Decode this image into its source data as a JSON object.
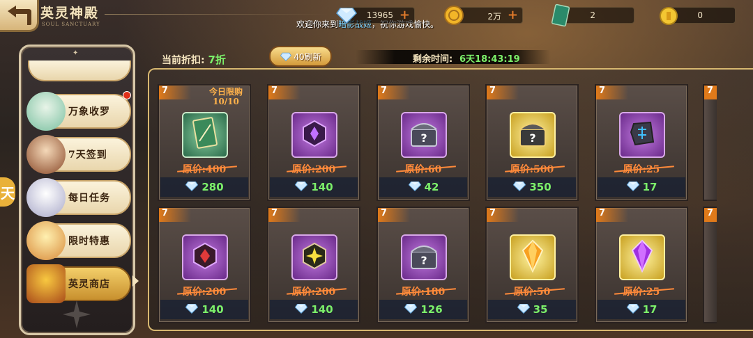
{
  "header": {
    "title": "英灵神殿",
    "subtitle": "SOUL SANCTUARY",
    "welcome_prefix": "欢迎你来到",
    "welcome_highlight": "暗影战姬",
    "welcome_suffix": "，祝你游戏愉快。"
  },
  "resources": [
    {
      "icon": "diamond-icon",
      "value": "13965",
      "has_plus": true
    },
    {
      "icon": "gold-coin-icon",
      "value": "2万",
      "has_plus": true
    },
    {
      "icon": "ticket-card-icon",
      "value": "2",
      "has_plus": false
    },
    {
      "icon": "token-coin-icon",
      "value": "0",
      "has_plus": false
    }
  ],
  "sidebar": {
    "items": [
      {
        "label": "万象收罗",
        "has_red_dot": true,
        "active": false
      },
      {
        "label": "7天签到",
        "has_red_dot": false,
        "active": false
      },
      {
        "label": "每日任务",
        "has_red_dot": false,
        "active": false
      },
      {
        "label": "限时特惠",
        "has_red_dot": false,
        "active": false
      },
      {
        "label": "英灵商店",
        "has_red_dot": false,
        "active": true
      }
    ],
    "left_tab_label": "天"
  },
  "shop": {
    "discount_label": "当前折扣:",
    "discount_value": "7折",
    "refresh_label": "40刷新",
    "timer_label": "剩余时间:",
    "timer_value": "6天18:43:19",
    "orig_price_prefix": "原价:",
    "items": [
      {
        "badge": "7",
        "limit_title": "今日限购",
        "limit_count": "10/10",
        "item_icon": "green-card-icon",
        "box_color": "green",
        "orig_price": "400",
        "price": "280"
      },
      {
        "badge": "7",
        "item_icon": "purple-crystal-icon",
        "box_color": "purple",
        "orig_price": "200",
        "price": "140"
      },
      {
        "badge": "7",
        "item_icon": "mystery-chest-icon",
        "box_color": "purple",
        "orig_price": "60",
        "price": "42"
      },
      {
        "badge": "7",
        "item_icon": "gold-mystery-chest-icon",
        "box_color": "gold",
        "orig_price": "500",
        "price": "350"
      },
      {
        "badge": "7",
        "item_icon": "rune-stone-icon",
        "box_color": "purple",
        "orig_price": "25",
        "price": "17"
      },
      {
        "badge": "7",
        "item_icon": "red-crystal-icon",
        "box_color": "purple",
        "orig_price": "200",
        "price": "140"
      },
      {
        "badge": "7",
        "item_icon": "yellow-star-crystal-icon",
        "box_color": "purple",
        "orig_price": "200",
        "price": "140"
      },
      {
        "badge": "7",
        "item_icon": "mystery-chest-icon",
        "box_color": "purple",
        "orig_price": "180",
        "price": "126"
      },
      {
        "badge": "7",
        "item_icon": "orange-gem-icon",
        "box_color": "gold",
        "orig_price": "50",
        "price": "35"
      },
      {
        "badge": "7",
        "item_icon": "purple-gem-icon",
        "box_color": "gold",
        "orig_price": "25",
        "price": "17"
      }
    ],
    "partial_badges": [
      "7",
      "7"
    ]
  }
}
